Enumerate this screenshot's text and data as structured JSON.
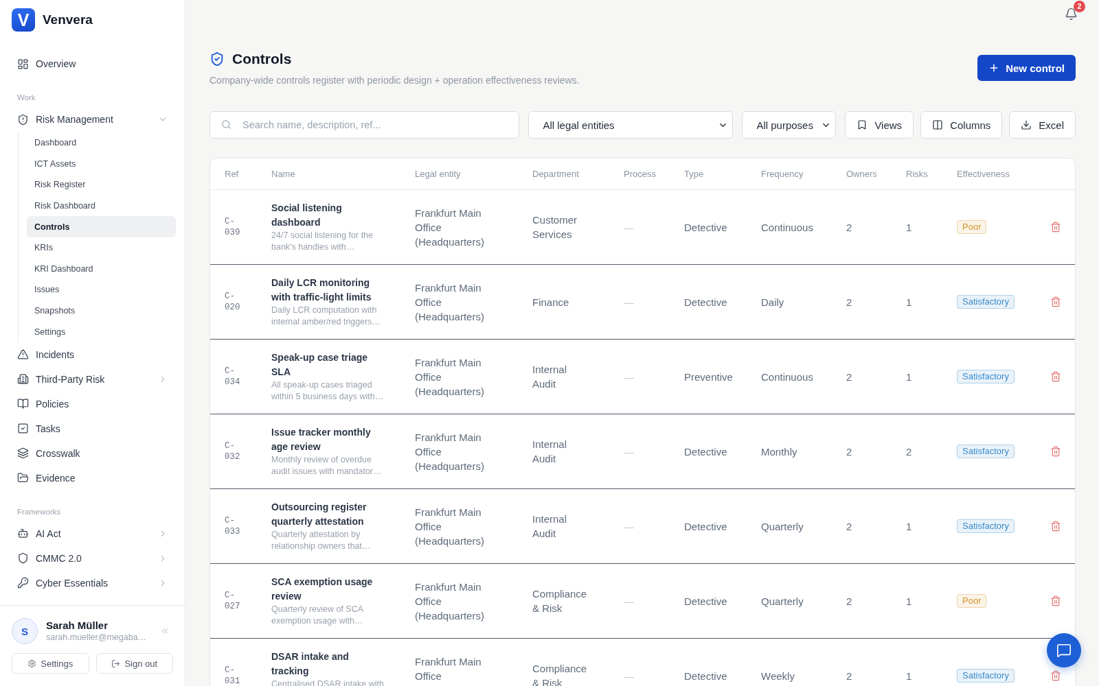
{
  "brand": {
    "mark": "V",
    "name": "Venvera"
  },
  "sidebar": {
    "sections": [
      {
        "items": [
          {
            "label": "Overview",
            "selected": false
          }
        ]
      },
      {
        "label": "Work",
        "items": [
          {
            "label": "Risk Management",
            "selected": false,
            "expanded": true,
            "children": [
              {
                "label": "Dashboard",
                "selected": false
              },
              {
                "label": "ICT Assets",
                "selected": false
              },
              {
                "label": "Risk Register",
                "selected": false
              },
              {
                "label": "Risk Dashboard",
                "selected": false
              },
              {
                "label": "Controls",
                "selected": true
              },
              {
                "label": "KRIs",
                "selected": false
              },
              {
                "label": "KRI Dashboard",
                "selected": false
              },
              {
                "label": "Issues",
                "selected": false
              },
              {
                "label": "Snapshots",
                "selected": false
              },
              {
                "label": "Settings",
                "selected": false
              }
            ]
          },
          {
            "label": "Incidents",
            "selected": false
          },
          {
            "label": "Third-Party Risk",
            "selected": false,
            "expanded": false
          },
          {
            "label": "Policies",
            "selected": false
          },
          {
            "label": "Tasks",
            "selected": false
          },
          {
            "label": "Crosswalk",
            "selected": false
          },
          {
            "label": "Evidence",
            "selected": false
          }
        ]
      },
      {
        "label": "Frameworks",
        "items": [
          {
            "label": "AI Act",
            "selected": false,
            "expanded": false
          },
          {
            "label": "CMMC 2.0",
            "selected": false,
            "expanded": false
          },
          {
            "label": "Cyber Essentials",
            "selected": false,
            "expanded": false
          }
        ]
      }
    ]
  },
  "user": {
    "initial": "S",
    "name": "Sarah Müller",
    "email": "sarah.mueller@megaba…",
    "actions": [
      "Settings",
      "Sign out"
    ]
  },
  "topbar": {
    "notifications": "2"
  },
  "page": {
    "title": "Controls",
    "subtitle": "Company-wide controls register with periodic design + operation effectiveness reviews.",
    "action": "New control"
  },
  "toolbar": {
    "search": {
      "placeholder": "Search name, description, ref..."
    },
    "filters": [
      {
        "value": "All legal entities"
      },
      {
        "value": "All purposes"
      }
    ],
    "buttons": [
      "Views",
      "Columns",
      "Excel"
    ]
  },
  "table": {
    "columns": [
      "Ref",
      "Name",
      "Legal entity",
      "Department",
      "Process",
      "Type",
      "Frequency",
      "Owners",
      "Risks",
      "Effectiveness"
    ],
    "rows": [
      {
        "ref": "C-039",
        "name": "Social listening dashboard",
        "description": "24/7 social listening for the bank's handles with…",
        "legal_entity": "Frankfurt Main Office (Headquarters)",
        "department": "Customer Services",
        "process": "—",
        "type": "Detective",
        "frequency": "Continuous",
        "owners": "2",
        "risks": "1",
        "effectiveness": {
          "label": "Poor",
          "color": "#d4962b"
        }
      },
      {
        "ref": "C-020",
        "name": "Daily LCR monitoring with traffic-light limits",
        "description": "Daily LCR computation with internal amber/red triggers…",
        "legal_entity": "Frankfurt Main Office (Headquarters)",
        "department": "Finance",
        "process": "—",
        "type": "Detective",
        "frequency": "Daily",
        "owners": "2",
        "risks": "1",
        "effectiveness": {
          "label": "Satisfactory",
          "color": "#3a8ccc"
        }
      },
      {
        "ref": "C-034",
        "name": "Speak-up case triage SLA",
        "description": "All speak-up cases triaged within 5 business days with…",
        "legal_entity": "Frankfurt Main Office (Headquarters)",
        "department": "Internal Audit",
        "process": "—",
        "type": "Preventive",
        "frequency": "Continuous",
        "owners": "2",
        "risks": "1",
        "effectiveness": {
          "label": "Satisfactory",
          "color": "#3a8ccc"
        }
      },
      {
        "ref": "C-032",
        "name": "Issue tracker monthly age review",
        "description": "Monthly review of overdue audit issues with mandator…",
        "legal_entity": "Frankfurt Main Office (Headquarters)",
        "department": "Internal Audit",
        "process": "—",
        "type": "Detective",
        "frequency": "Monthly",
        "owners": "2",
        "risks": "2",
        "effectiveness": {
          "label": "Satisfactory",
          "color": "#3a8ccc"
        }
      },
      {
        "ref": "C-033",
        "name": "Outsourcing register quarterly attestation",
        "description": "Quarterly attestation by relationship owners that…",
        "legal_entity": "Frankfurt Main Office (Headquarters)",
        "department": "Internal Audit",
        "process": "—",
        "type": "Detective",
        "frequency": "Quarterly",
        "owners": "2",
        "risks": "1",
        "effectiveness": {
          "label": "Satisfactory",
          "color": "#3a8ccc"
        }
      },
      {
        "ref": "C-027",
        "name": "SCA exemption usage review",
        "description": "Quarterly review of SCA exemption usage with…",
        "legal_entity": "Frankfurt Main Office (Headquarters)",
        "department": "Compliance & Risk",
        "process": "—",
        "type": "Detective",
        "frequency": "Quarterly",
        "owners": "2",
        "risks": "1",
        "effectiveness": {
          "label": "Poor",
          "color": "#d4962b"
        }
      },
      {
        "ref": "C-031",
        "name": "DSAR intake and tracking",
        "description": "Centralised DSAR intake with",
        "legal_entity": "Frankfurt Main Office",
        "department": "Compliance & Risk",
        "process": "—",
        "type": "Detective",
        "frequency": "Weekly",
        "owners": "2",
        "risks": "1",
        "effectiveness": {
          "label": "Satisfactory",
          "color": "#3a8ccc"
        }
      }
    ]
  }
}
